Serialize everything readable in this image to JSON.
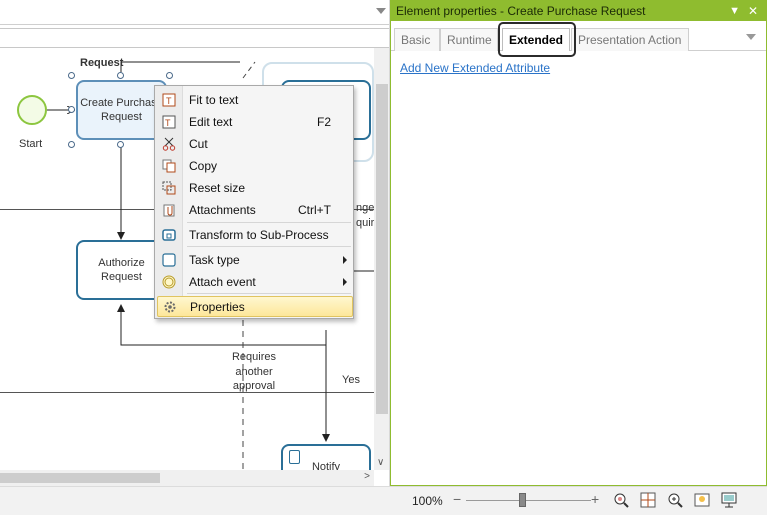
{
  "diagram": {
    "pool_label": "Request",
    "start_label": "Start",
    "tasks": {
      "create": "Create Purchase Request",
      "authorize": "Authorize Request",
      "notify": "Notify"
    },
    "flow_labels": {
      "requires": "Requires another approval",
      "yes": "Yes",
      "partial_1": "nge",
      "partial_2": "quir"
    }
  },
  "context_menu": {
    "items": [
      {
        "label": "Fit to text",
        "shortcut": "",
        "icon": "fit-to-text-icon"
      },
      {
        "label": "Edit text",
        "shortcut": "F2",
        "icon": "edit-text-icon"
      },
      {
        "label": "Cut",
        "shortcut": "",
        "icon": "scissors-icon"
      },
      {
        "label": "Copy",
        "shortcut": "",
        "icon": "copy-icon"
      },
      {
        "label": "Reset size",
        "shortcut": "",
        "icon": "reset-size-icon"
      },
      {
        "label": "Attachments",
        "shortcut": "Ctrl+T",
        "icon": "paperclip-icon"
      },
      {
        "label": "Transform to Sub-Process",
        "shortcut": "",
        "icon": "subprocess-icon"
      },
      {
        "label": "Task type",
        "shortcut": "",
        "icon": "task-type-icon"
      },
      {
        "label": "Attach event",
        "shortcut": "",
        "icon": "attach-event-icon"
      },
      {
        "label": "Properties",
        "shortcut": "",
        "icon": "gear-icon"
      }
    ]
  },
  "properties_panel": {
    "title": "Element properties - Create Purchase Request",
    "tabs": [
      "Basic",
      "Runtime",
      "Extended",
      "Presentation Action"
    ],
    "active_tab": "Extended",
    "link": "Add New Extended Attribute"
  },
  "statusbar": {
    "zoom": "100%",
    "zoom_out": "−",
    "zoom_in": "+",
    "zoom_level_fraction": 0.45
  },
  "colors": {
    "panel_accent": "#8fbc2f",
    "task_border": "#2a6f97",
    "link": "#2a73c8",
    "menu_highlight": "#fde79a",
    "start_event": "#8cc63f"
  }
}
